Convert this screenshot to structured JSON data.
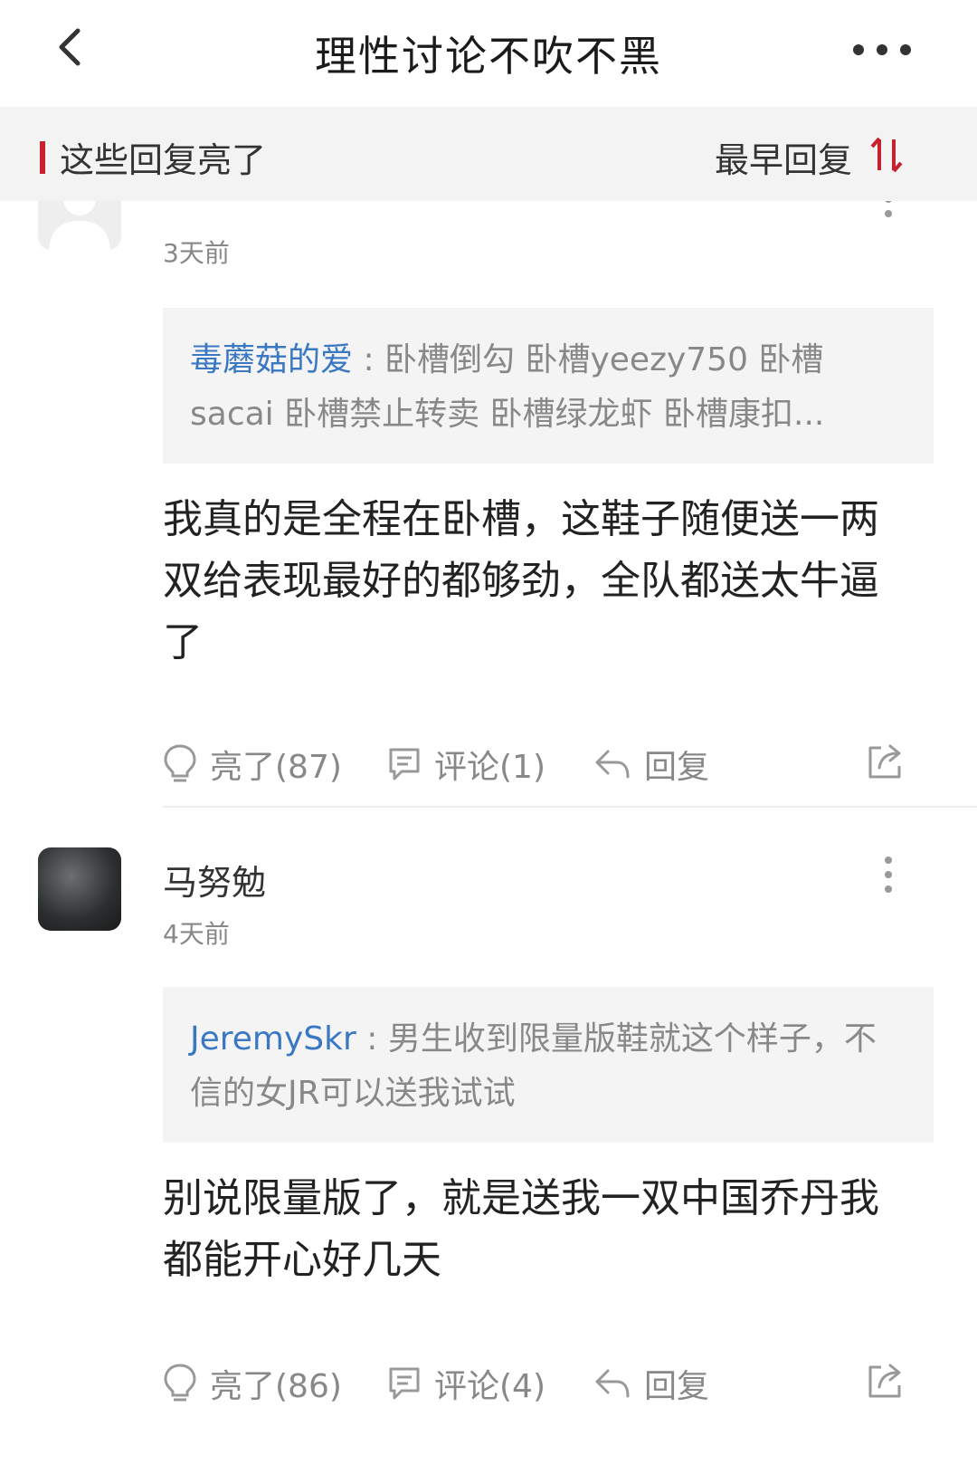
{
  "header": {
    "title": "理性讨论不吹不黑"
  },
  "sortbar": {
    "label": "这些回复亮了",
    "order_label": "最早回复"
  },
  "comments": [
    {
      "username": "",
      "time": "3天前",
      "quote_user": "毒蘑菇的爱",
      "quote_sep": " : ",
      "quote_text": "卧槽倒勾 卧槽yeezy750 卧槽sacai 卧槽禁止转卖 卧槽绿龙虾 卧槽康扣...",
      "content": "我真的是全程在卧槽，这鞋子随便送一两双给表现最好的都够劲，全队都送太牛逼了",
      "like_label": "亮了(87)",
      "comment_label": "评论(1)",
      "reply_label": "回复"
    },
    {
      "username": "马努勉",
      "time": "4天前",
      "quote_user": "JeremySkr",
      "quote_sep": " : ",
      "quote_text": "男生收到限量版鞋就这个样子，不信的女JR可以送我试试",
      "content": "别说限量版了，就是送我一双中国乔丹我都能开心好几天",
      "like_label": "亮了(86)",
      "comment_label": "评论(4)",
      "reply_label": "回复"
    }
  ],
  "colors": {
    "accent": "#c8202f",
    "link": "#3b78c4",
    "muted": "#888888"
  },
  "icons": [
    "back-arrow-icon",
    "more-dots-icon",
    "sort-icon",
    "default-avatar-icon",
    "kebab-icon",
    "lightbulb-icon",
    "comment-bubble-icon",
    "reply-arrow-icon",
    "share-icon"
  ]
}
